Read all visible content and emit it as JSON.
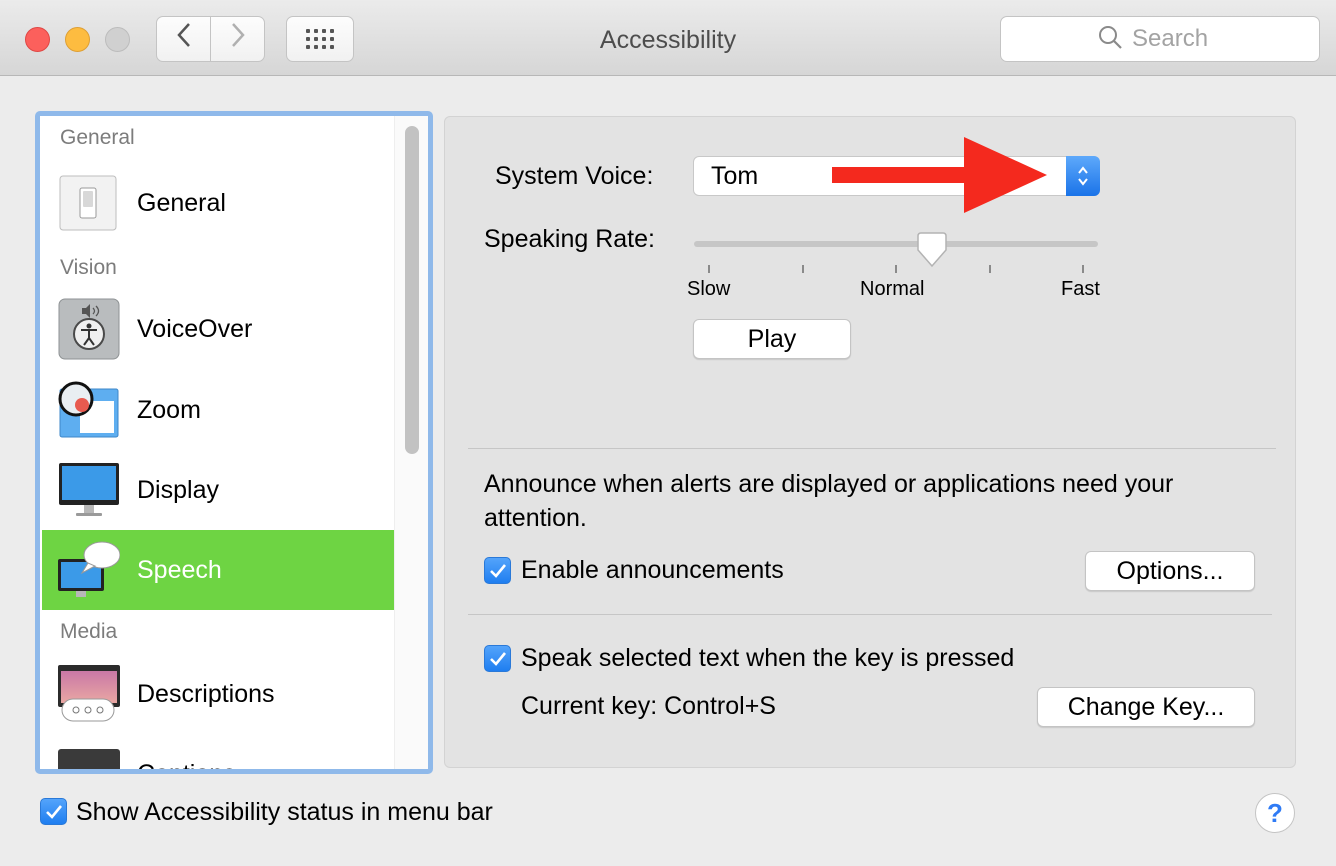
{
  "window": {
    "title": "Accessibility"
  },
  "toolbar": {
    "back_label": "‹",
    "forward_label": "›"
  },
  "search": {
    "placeholder": "Search"
  },
  "sidebar": {
    "sections": [
      {
        "label": "General"
      },
      {
        "label": "Vision"
      },
      {
        "label": "Media"
      }
    ],
    "items": [
      {
        "label": "General",
        "icon": "general-switch-icon"
      },
      {
        "label": "VoiceOver",
        "icon": "voiceover-icon"
      },
      {
        "label": "Zoom",
        "icon": "zoom-magnifier-icon"
      },
      {
        "label": "Display",
        "icon": "display-monitor-icon"
      },
      {
        "label": "Speech",
        "icon": "speech-bubble-icon",
        "selected": true
      },
      {
        "label": "Descriptions",
        "icon": "descriptions-icon"
      },
      {
        "label": "Captions",
        "icon": "captions-icon"
      }
    ]
  },
  "speech": {
    "system_voice_label": "System Voice:",
    "system_voice_value": "Tom",
    "speaking_rate_label": "Speaking Rate:",
    "rate_slow": "Slow",
    "rate_normal": "Normal",
    "rate_fast": "Fast",
    "rate_value": 0.6,
    "play_label": "Play",
    "announce_text_1": "Announce when alerts are displayed or applications need your",
    "announce_text_2": "attention.",
    "enable_announcements_label": "Enable announcements",
    "enable_announcements_checked": true,
    "options_label": "Options...",
    "speak_selected_label": "Speak selected text when the key is pressed",
    "speak_selected_checked": true,
    "current_key_label": "Current key: Control+S",
    "change_key_label": "Change Key..."
  },
  "footer": {
    "show_status_label": "Show Accessibility status in menu bar",
    "show_status_checked": true,
    "help_label": "?"
  },
  "colors": {
    "accent": "#1f7ef0",
    "selection": "#6ed443",
    "annotation_arrow": "#f4291e"
  }
}
